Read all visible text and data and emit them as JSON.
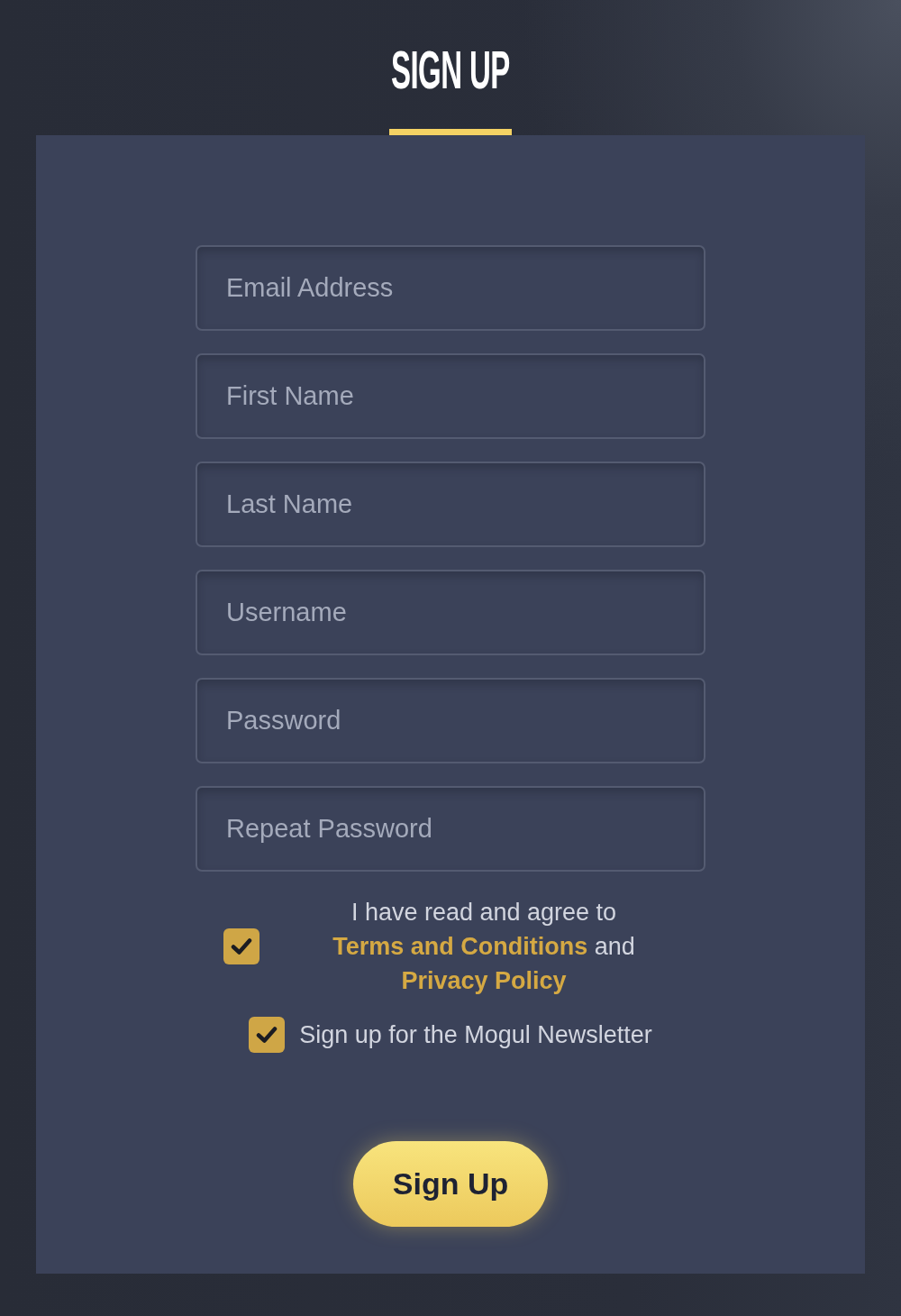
{
  "header": {
    "title": "SIGN UP"
  },
  "form": {
    "fields": [
      {
        "placeholder": "Email Address"
      },
      {
        "placeholder": "First Name"
      },
      {
        "placeholder": "Last Name"
      },
      {
        "placeholder": "Username"
      },
      {
        "placeholder": "Password"
      },
      {
        "placeholder": "Repeat Password"
      }
    ],
    "agreements": [
      {
        "checked": true,
        "parts": [
          {
            "kind": "plain",
            "text": "I have read and agree to "
          },
          {
            "kind": "link",
            "text": "Terms and Conditions"
          },
          {
            "kind": "plain",
            "text": " and "
          },
          {
            "kind": "link",
            "text": "Privacy Policy"
          }
        ]
      },
      {
        "checked": true,
        "parts": [
          {
            "kind": "plain",
            "text": "Sign up for the Mogul Newsletter"
          }
        ]
      }
    ],
    "submit": {
      "label": "Sign Up"
    }
  }
}
